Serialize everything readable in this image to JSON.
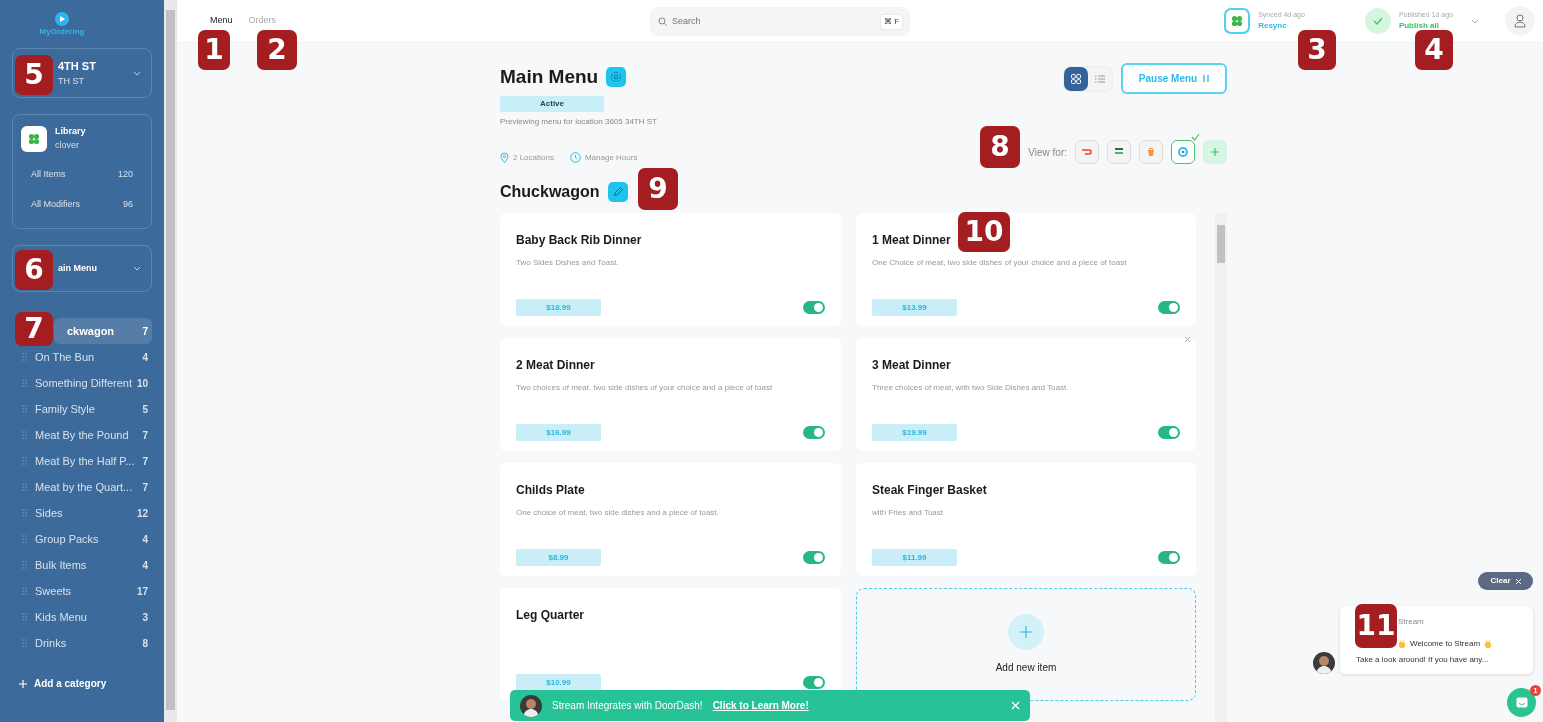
{
  "sidebar": {
    "logo_text": "MyOrdering",
    "location": {
      "name": "4TH ST",
      "address": "TH ST"
    },
    "library": {
      "title": "Library",
      "subtitle": "clover",
      "rows": [
        {
          "label": "All Items",
          "count": "120"
        },
        {
          "label": "All Modifiers",
          "count": "96"
        }
      ]
    },
    "menu_select": {
      "label": "ain Menu"
    },
    "categories": [
      {
        "name": "ckwagon",
        "count": "7",
        "selected": true
      },
      {
        "name": "On The Bun",
        "count": "4",
        "selected": false
      },
      {
        "name": "Something Different",
        "count": "10",
        "selected": false
      },
      {
        "name": "Family Style",
        "count": "5",
        "selected": false
      },
      {
        "name": "Meat By the Pound",
        "count": "7",
        "selected": false
      },
      {
        "name": "Meat By the Half P...",
        "count": "7",
        "selected": false
      },
      {
        "name": "Meat by the Quart...",
        "count": "7",
        "selected": false
      },
      {
        "name": "Sides",
        "count": "12",
        "selected": false
      },
      {
        "name": "Group Packs",
        "count": "4",
        "selected": false
      },
      {
        "name": "Bulk Items",
        "count": "4",
        "selected": false
      },
      {
        "name": "Sweets",
        "count": "17",
        "selected": false
      },
      {
        "name": "Kids Menu",
        "count": "3",
        "selected": false
      },
      {
        "name": "Drinks",
        "count": "8",
        "selected": false
      }
    ],
    "add_category": "Add a category"
  },
  "top_nav": {
    "tabs": [
      {
        "label": "Menu",
        "selected": true
      },
      {
        "label": "Orders",
        "selected": false
      }
    ],
    "search": {
      "placeholder": "Search",
      "shortcut": "⌘ F"
    },
    "sync": {
      "caption": "Synced 4d ago",
      "action": "Resync"
    },
    "publish": {
      "caption": "Published 1d ago",
      "action": "Publish all"
    }
  },
  "menu": {
    "title": "Main Menu",
    "status": "Active",
    "preview_note": "Previewing menu for location 3605 34TH ST",
    "locations": "2 Locations",
    "hours": "Manage Hours",
    "pause_button": "Pause Menu",
    "views": [
      {
        "kind": "grid",
        "selected": true
      },
      {
        "kind": "list",
        "selected": false
      }
    ],
    "view_for_label": "View for:",
    "channels": [
      {
        "kind": "doordash",
        "selected": false
      },
      {
        "kind": "ubereats",
        "selected": false
      },
      {
        "kind": "grubhub",
        "selected": false
      },
      {
        "kind": "myordering",
        "selected": true
      }
    ]
  },
  "category": {
    "title": "Chuckwagon",
    "items": [
      {
        "name": "Baby Back Rib Dinner",
        "description": "Two Sides Dishes and Toast.",
        "price": "$18.99",
        "on": true,
        "closable": false
      },
      {
        "name": "1 Meat Dinner",
        "description": "One Choice of meat, two side dishes of your choice and a piece of toast",
        "price": "$13.99",
        "on": true,
        "closable": false
      },
      {
        "name": "2 Meat Dinner",
        "description": "Two choices of meat, two side dishes of your choice and a piece of toast",
        "price": "$16.99",
        "on": true,
        "closable": false
      },
      {
        "name": "3 Meat Dinner",
        "description": "Three choices of meat, with two Side Dishes and Toast.",
        "price": "$19.99",
        "on": true,
        "closable": true
      },
      {
        "name": "Childs Plate",
        "description": "One choice of meat, two side dishes and a piece of toast.",
        "price": "$8.99",
        "on": true,
        "closable": false
      },
      {
        "name": "Steak Finger Basket",
        "description": "with Fries and Toast",
        "price": "$11.99",
        "on": true,
        "closable": false
      },
      {
        "name": "Leg Quarter",
        "price": "$10.99",
        "on": true,
        "closable": false
      }
    ],
    "add_item": "Add new item"
  },
  "banner": {
    "text": "Stream Integrates with DoorDash!",
    "link": "Click to Learn More!"
  },
  "chat": {
    "clear": "Clear",
    "sender": "Stream",
    "greeting": "Welcome to Stream",
    "preview": "Take a look around! If you have any...",
    "unread": "1"
  },
  "callouts": [
    {
      "label": "1"
    },
    {
      "label": "2"
    },
    {
      "label": "3"
    },
    {
      "label": "4"
    },
    {
      "label": "5"
    },
    {
      "label": "6"
    },
    {
      "label": "7"
    },
    {
      "label": "8"
    },
    {
      "label": "9"
    },
    {
      "label": "10"
    },
    {
      "label": "11"
    }
  ]
}
